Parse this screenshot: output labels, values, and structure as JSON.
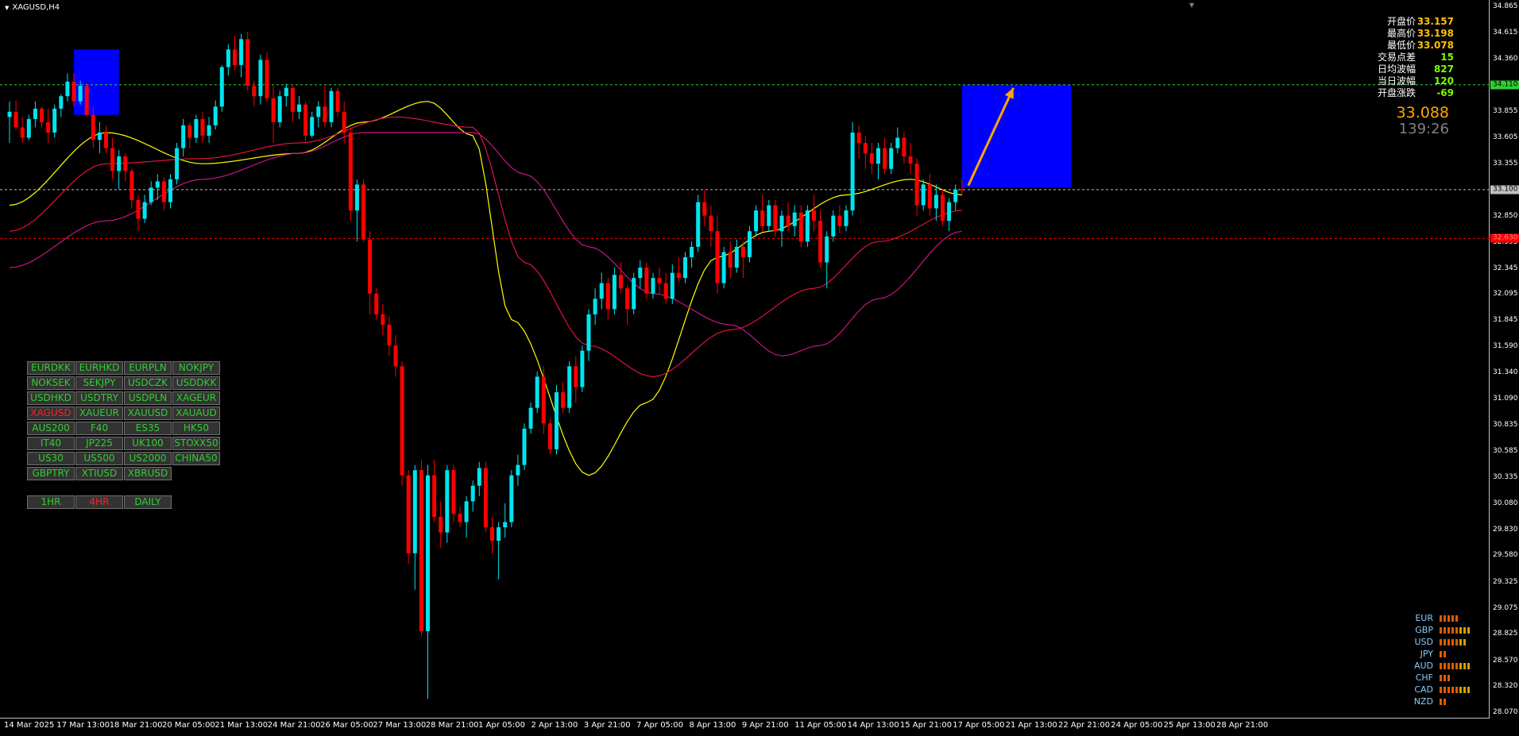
{
  "window": {
    "title": "XAGUSD,H4"
  },
  "price_axis": {
    "ticks": [
      "34.865",
      "34.615",
      "34.360",
      "34.110",
      "33.855",
      "33.605",
      "33.355",
      "33.100",
      "32.850",
      "32.595",
      "32.345",
      "32.095",
      "31.845",
      "31.590",
      "31.340",
      "31.090",
      "30.835",
      "30.585",
      "30.335",
      "30.080",
      "29.830",
      "29.580",
      "29.325",
      "29.075",
      "28.825",
      "28.570",
      "28.320",
      "28.070"
    ],
    "boxes": [
      {
        "label": "34.110",
        "value": 34.11,
        "bg": "#32cd32",
        "fg": "#000000"
      },
      {
        "label": "33.100",
        "value": 33.1,
        "bg": "#c0c0c0",
        "fg": "#000000"
      },
      {
        "label": "32.630",
        "value": 32.63,
        "bg": "#ff0000",
        "fg": "#ff8080"
      }
    ]
  },
  "time_axis": {
    "labels": [
      "14 Mar 2025",
      "17 Mar 13:00",
      "18 Mar 21:00",
      "20 Mar 05:00",
      "21 Mar 13:00",
      "24 Mar 21:00",
      "26 Mar 05:00",
      "27 Mar 13:00",
      "28 Mar 21:00",
      "1 Apr 05:00",
      "2 Apr 13:00",
      "3 Apr 21:00",
      "7 Apr 05:00",
      "8 Apr 13:00",
      "9 Apr 21:00",
      "11 Apr 05:00",
      "14 Apr 13:00",
      "15 Apr 21:00",
      "17 Apr 05:00",
      "21 Apr 13:00",
      "22 Apr 21:00",
      "24 Apr 05:00",
      "25 Apr 13:00",
      "28 Apr 21:00"
    ]
  },
  "info_panel": {
    "rows": [
      {
        "label": "开盘价",
        "value": "33.157"
      },
      {
        "label": "最高价",
        "value": "33.198"
      },
      {
        "label": "最低价",
        "value": "33.078"
      },
      {
        "label": "交易点差",
        "value": "15"
      },
      {
        "label": "日均波幅",
        "value": "827"
      },
      {
        "label": "当日波幅",
        "value": "120"
      },
      {
        "label": "开盘涨跌",
        "value": "-69"
      }
    ],
    "last_price": "33.088",
    "countdown": "139:26"
  },
  "symbols": [
    "EURDKK",
    "EURHKD",
    "EURPLN",
    "NOKJPY",
    "NOKSEK",
    "SEKJPY",
    "USDCZK",
    "USDDKK",
    "USDHKD",
    "USDTRY",
    "USDPLN",
    "XAGEUR",
    "XAGUSD",
    "XAUEUR",
    "XAUUSD",
    "XAUAUD",
    "AUS200",
    "F40",
    "ES35",
    "HK50",
    "IT40",
    "JP225",
    "UK100",
    "STOXX50",
    "US30",
    "US500",
    "US2000",
    "CHINA50",
    "GBPTRY",
    "XTIUSD",
    "XBRUSD"
  ],
  "active_symbol": "XAGUSD",
  "timeframes": [
    "1HR",
    "4HR",
    "DAILY"
  ],
  "active_timeframe": "4HR",
  "currency_strength": [
    {
      "name": "EUR",
      "level": 5
    },
    {
      "name": "GBP",
      "level": 8
    },
    {
      "name": "USD",
      "level": 7
    },
    {
      "name": "JPY",
      "level": 2
    },
    {
      "name": "AUD",
      "level": 8
    },
    {
      "name": "CHF",
      "level": 3
    },
    {
      "name": "CAD",
      "level": 8
    },
    {
      "name": "NZD",
      "level": 2
    }
  ],
  "colors": {
    "bull": "#00e5ee",
    "bear": "#ff0000",
    "ma_fast": "#ffff00",
    "ma_mid": "#dc143c",
    "ma_slow": "#c71585",
    "zone": "#0000ff",
    "arrow": "#ffa500",
    "accent": "#ffc000"
  },
  "chart_data": {
    "type": "candlestick",
    "symbol": "XAGUSD",
    "timeframe": "H4",
    "ylim": [
      28.07,
      34.865
    ],
    "grid": false,
    "horizontal_levels": [
      {
        "value": 34.11,
        "color": "#32cd32",
        "style": "dotted"
      },
      {
        "value": 33.1,
        "color": "#c0c0c0",
        "style": "dotted"
      },
      {
        "value": 32.63,
        "color": "#ff0000",
        "style": "dotted"
      }
    ],
    "candles": [
      [
        33.8,
        33.95,
        33.55,
        33.85
      ],
      [
        33.85,
        33.96,
        33.68,
        33.7
      ],
      [
        33.7,
        33.8,
        33.55,
        33.6
      ],
      [
        33.6,
        33.82,
        33.58,
        33.78
      ],
      [
        33.78,
        33.95,
        33.7,
        33.88
      ],
      [
        33.88,
        33.9,
        33.7,
        33.75
      ],
      [
        33.75,
        33.88,
        33.55,
        33.65
      ],
      [
        33.65,
        33.92,
        33.6,
        33.88
      ],
      [
        33.88,
        34.02,
        33.8,
        34.0
      ],
      [
        34.0,
        34.22,
        33.95,
        34.14
      ],
      [
        34.14,
        34.22,
        33.9,
        33.95
      ],
      [
        33.95,
        34.15,
        33.92,
        34.1
      ],
      [
        34.1,
        34.12,
        33.8,
        33.82
      ],
      [
        33.82,
        33.9,
        33.5,
        33.58
      ],
      [
        33.58,
        33.75,
        33.45,
        33.65
      ],
      [
        33.65,
        33.72,
        33.45,
        33.5
      ],
      [
        33.5,
        33.6,
        33.2,
        33.28
      ],
      [
        33.28,
        33.48,
        33.1,
        33.42
      ],
      [
        33.42,
        33.45,
        33.18,
        33.28
      ],
      [
        33.28,
        33.3,
        32.92,
        33.0
      ],
      [
        33.0,
        33.05,
        32.7,
        32.82
      ],
      [
        32.82,
        33.05,
        32.78,
        32.98
      ],
      [
        32.98,
        33.18,
        32.95,
        33.12
      ],
      [
        33.12,
        33.25,
        33.0,
        33.18
      ],
      [
        33.18,
        33.22,
        32.9,
        32.98
      ],
      [
        32.98,
        33.25,
        32.92,
        33.2
      ],
      [
        33.2,
        33.55,
        33.15,
        33.5
      ],
      [
        33.5,
        33.78,
        33.42,
        33.72
      ],
      [
        33.72,
        33.75,
        33.5,
        33.6
      ],
      [
        33.6,
        33.82,
        33.55,
        33.78
      ],
      [
        33.78,
        33.85,
        33.55,
        33.62
      ],
      [
        33.62,
        33.8,
        33.55,
        33.72
      ],
      [
        33.72,
        33.96,
        33.68,
        33.9
      ],
      [
        33.9,
        34.3,
        33.85,
        34.28
      ],
      [
        34.28,
        34.5,
        34.2,
        34.45
      ],
      [
        34.45,
        34.58,
        34.25,
        34.3
      ],
      [
        34.3,
        34.6,
        34.18,
        34.55
      ],
      [
        34.55,
        34.62,
        34.05,
        34.1
      ],
      [
        34.1,
        34.15,
        33.9,
        34.0
      ],
      [
        34.0,
        34.4,
        33.92,
        34.35
      ],
      [
        34.35,
        34.42,
        33.95,
        33.98
      ],
      [
        33.98,
        34.1,
        33.55,
        33.75
      ],
      [
        33.75,
        34.05,
        33.7,
        34.0
      ],
      [
        34.0,
        34.12,
        33.9,
        34.08
      ],
      [
        34.08,
        34.1,
        33.75,
        33.85
      ],
      [
        33.85,
        34.0,
        33.78,
        33.92
      ],
      [
        33.92,
        33.95,
        33.55,
        33.62
      ],
      [
        33.62,
        33.85,
        33.6,
        33.8
      ],
      [
        33.8,
        33.95,
        33.7,
        33.9
      ],
      [
        33.9,
        34.1,
        33.7,
        33.75
      ],
      [
        33.75,
        34.08,
        33.7,
        34.05
      ],
      [
        34.05,
        34.08,
        33.8,
        33.85
      ],
      [
        33.85,
        33.95,
        33.55,
        33.65
      ],
      [
        33.65,
        33.7,
        32.8,
        32.9
      ],
      [
        32.9,
        33.2,
        32.6,
        33.15
      ],
      [
        33.15,
        33.2,
        32.6,
        32.62
      ],
      [
        32.62,
        32.7,
        31.9,
        32.1
      ],
      [
        32.1,
        32.15,
        31.85,
        31.9
      ],
      [
        31.9,
        32.0,
        31.7,
        31.8
      ],
      [
        31.8,
        31.88,
        31.5,
        31.6
      ],
      [
        31.6,
        31.7,
        31.3,
        31.4
      ],
      [
        31.4,
        31.45,
        30.25,
        30.35
      ],
      [
        30.35,
        30.4,
        29.5,
        29.6
      ],
      [
        29.6,
        30.45,
        29.25,
        30.4
      ],
      [
        30.4,
        30.5,
        28.8,
        28.85
      ],
      [
        28.85,
        30.45,
        28.2,
        30.35
      ],
      [
        30.35,
        30.5,
        29.9,
        29.95
      ],
      [
        29.95,
        30.1,
        29.65,
        29.8
      ],
      [
        29.8,
        30.45,
        29.7,
        30.4
      ],
      [
        30.4,
        30.45,
        29.9,
        29.98
      ],
      [
        29.98,
        30.05,
        29.85,
        29.9
      ],
      [
        29.9,
        30.15,
        29.75,
        30.1
      ],
      [
        30.1,
        30.3,
        30.0,
        30.25
      ],
      [
        30.25,
        30.48,
        30.15,
        30.42
      ],
      [
        30.42,
        30.48,
        29.8,
        29.85
      ],
      [
        29.85,
        29.95,
        29.6,
        29.72
      ],
      [
        29.72,
        29.9,
        29.35,
        29.85
      ],
      [
        29.85,
        30.08,
        29.75,
        29.9
      ],
      [
        29.9,
        30.4,
        29.85,
        30.35
      ],
      [
        30.35,
        30.55,
        30.25,
        30.45
      ],
      [
        30.45,
        30.85,
        30.4,
        30.8
      ],
      [
        30.8,
        31.05,
        30.75,
        31.0
      ],
      [
        31.0,
        31.35,
        30.95,
        31.3
      ],
      [
        31.3,
        31.4,
        30.75,
        30.85
      ],
      [
        30.85,
        30.9,
        30.55,
        30.6
      ],
      [
        30.6,
        31.22,
        30.55,
        31.15
      ],
      [
        31.15,
        31.25,
        30.95,
        31.0
      ],
      [
        31.0,
        31.45,
        30.95,
        31.4
      ],
      [
        31.4,
        31.5,
        31.05,
        31.2
      ],
      [
        31.2,
        31.6,
        31.15,
        31.55
      ],
      [
        31.55,
        31.95,
        31.45,
        31.9
      ],
      [
        31.9,
        32.15,
        31.8,
        32.05
      ],
      [
        32.05,
        32.3,
        31.95,
        32.2
      ],
      [
        32.2,
        32.25,
        31.85,
        31.95
      ],
      [
        31.95,
        32.35,
        31.9,
        32.28
      ],
      [
        32.28,
        32.4,
        32.1,
        32.15
      ],
      [
        32.15,
        32.18,
        31.8,
        31.95
      ],
      [
        31.95,
        32.3,
        31.9,
        32.25
      ],
      [
        32.25,
        32.42,
        32.15,
        32.35
      ],
      [
        32.35,
        32.4,
        32.05,
        32.1
      ],
      [
        32.1,
        32.3,
        32.05,
        32.25
      ],
      [
        32.25,
        32.35,
        32.1,
        32.2
      ],
      [
        32.2,
        32.3,
        32.0,
        32.05
      ],
      [
        32.05,
        32.38,
        32.0,
        32.3
      ],
      [
        32.3,
        32.45,
        32.2,
        32.25
      ],
      [
        32.25,
        32.5,
        32.2,
        32.45
      ],
      [
        32.45,
        32.6,
        32.35,
        32.55
      ],
      [
        32.55,
        33.05,
        32.5,
        32.98
      ],
      [
        32.98,
        33.1,
        32.75,
        32.85
      ],
      [
        32.85,
        32.95,
        32.55,
        32.7
      ],
      [
        32.7,
        32.85,
        32.1,
        32.2
      ],
      [
        32.2,
        32.55,
        32.15,
        32.5
      ],
      [
        32.5,
        32.6,
        32.25,
        32.35
      ],
      [
        32.35,
        32.62,
        32.3,
        32.55
      ],
      [
        32.55,
        32.6,
        32.25,
        32.45
      ],
      [
        32.45,
        32.75,
        32.4,
        32.7
      ],
      [
        32.7,
        32.95,
        32.65,
        32.9
      ],
      [
        32.9,
        33.05,
        32.7,
        32.75
      ],
      [
        32.75,
        33.0,
        32.7,
        32.95
      ],
      [
        32.95,
        33.0,
        32.65,
        32.7
      ],
      [
        32.7,
        32.9,
        32.55,
        32.85
      ],
      [
        32.85,
        32.98,
        32.7,
        32.75
      ],
      [
        32.75,
        32.95,
        32.65,
        32.88
      ],
      [
        32.88,
        32.95,
        32.55,
        32.6
      ],
      [
        32.6,
        32.95,
        32.55,
        32.9
      ],
      [
        32.9,
        33.05,
        32.7,
        32.8
      ],
      [
        32.8,
        32.9,
        32.35,
        32.4
      ],
      [
        32.4,
        32.7,
        32.15,
        32.65
      ],
      [
        32.65,
        32.9,
        32.6,
        32.85
      ],
      [
        32.85,
        32.95,
        32.68,
        32.75
      ],
      [
        32.75,
        32.95,
        32.7,
        32.9
      ],
      [
        32.9,
        33.75,
        32.85,
        33.65
      ],
      [
        33.65,
        33.72,
        33.4,
        33.55
      ],
      [
        33.55,
        33.62,
        33.3,
        33.45
      ],
      [
        33.45,
        33.55,
        33.25,
        33.35
      ],
      [
        33.35,
        33.55,
        33.2,
        33.5
      ],
      [
        33.5,
        33.6,
        33.25,
        33.3
      ],
      [
        33.3,
        33.55,
        33.25,
        33.5
      ],
      [
        33.5,
        33.7,
        33.45,
        33.6
      ],
      [
        33.6,
        33.65,
        33.35,
        33.42
      ],
      [
        33.42,
        33.55,
        33.25,
        33.35
      ],
      [
        33.35,
        33.4,
        32.85,
        32.95
      ],
      [
        32.95,
        33.2,
        32.9,
        33.15
      ],
      [
        33.15,
        33.25,
        32.85,
        32.92
      ],
      [
        32.92,
        33.15,
        32.8,
        33.05
      ],
      [
        33.05,
        33.1,
        32.75,
        32.8
      ],
      [
        32.8,
        33.02,
        32.7,
        32.98
      ],
      [
        32.98,
        33.15,
        32.9,
        33.1
      ],
      [
        33.1,
        33.2,
        33.05,
        33.09
      ]
    ],
    "moving_averages": [
      {
        "color": "#ffff00",
        "points": [
          [
            0,
            32.95
          ],
          [
            15,
            33.65
          ],
          [
            30,
            33.35
          ],
          [
            45,
            33.45
          ],
          [
            55,
            33.75
          ],
          [
            65,
            33.95
          ],
          [
            72,
            33.62
          ],
          [
            78,
            31.85
          ],
          [
            90,
            30.35
          ],
          [
            99,
            31.05
          ],
          [
            110,
            32.45
          ],
          [
            118,
            32.7
          ],
          [
            130,
            33.05
          ],
          [
            140,
            33.2
          ],
          [
            148,
            33.05
          ]
        ]
      },
      {
        "color": "#dc143c",
        "points": [
          [
            0,
            32.7
          ],
          [
            15,
            33.35
          ],
          [
            30,
            33.4
          ],
          [
            45,
            33.55
          ],
          [
            60,
            33.8
          ],
          [
            72,
            33.7
          ],
          [
            80,
            32.4
          ],
          [
            90,
            31.6
          ],
          [
            100,
            31.3
          ],
          [
            112,
            31.75
          ],
          [
            125,
            32.15
          ],
          [
            135,
            32.6
          ],
          [
            148,
            32.9
          ]
        ]
      },
      {
        "color": "#c71585",
        "points": [
          [
            0,
            32.35
          ],
          [
            15,
            32.8
          ],
          [
            30,
            33.2
          ],
          [
            45,
            33.45
          ],
          [
            55,
            33.65
          ],
          [
            72,
            33.65
          ],
          [
            80,
            33.25
          ],
          [
            90,
            32.55
          ],
          [
            100,
            32.1
          ],
          [
            112,
            31.8
          ],
          [
            120,
            31.5
          ],
          [
            126,
            31.6
          ],
          [
            135,
            32.05
          ],
          [
            148,
            32.7
          ]
        ]
      }
    ],
    "zones": [
      {
        "x0": 10,
        "x1": 17,
        "y0": 33.82,
        "y1": 34.45,
        "color": "#0000ff"
      },
      {
        "x0": 148,
        "x1": 165,
        "y0": 33.12,
        "y1": 34.11,
        "color": "#0000ff"
      }
    ],
    "arrow": {
      "x0": 149,
      "y0": 33.14,
      "x1": 156,
      "y1": 34.08,
      "color": "#ffa500"
    }
  }
}
